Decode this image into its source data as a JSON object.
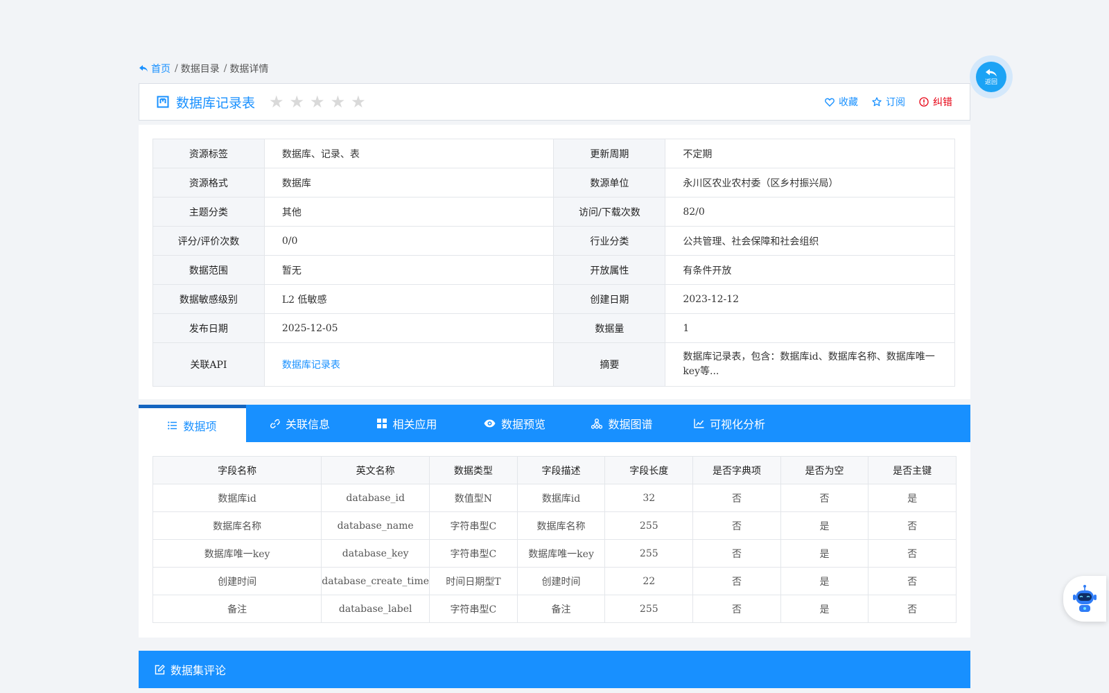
{
  "breadcrumb": {
    "home": "首页",
    "items": [
      "数据目录",
      "数据详情"
    ],
    "separator": "/"
  },
  "header": {
    "title": "数据库记录表",
    "rating_stars": 0,
    "rating_max": 5,
    "actions": {
      "favorite": "收藏",
      "subscribe": "订阅",
      "report": "纠错"
    }
  },
  "info": {
    "rows": [
      {
        "k1": "资源标签",
        "v1": "数据库、记录、表",
        "k2": "更新周期",
        "v2": "不定期"
      },
      {
        "k1": "资源格式",
        "v1": "数据库",
        "k2": "数源单位",
        "v2": "永川区农业农村委（区乡村振兴局）"
      },
      {
        "k1": "主题分类",
        "v1": "其他",
        "k2": "访问/下载次数",
        "v2": "82/0"
      },
      {
        "k1": "评分/评价次数",
        "v1": "0/0",
        "k2": "行业分类",
        "v2": "公共管理、社会保障和社会组织"
      },
      {
        "k1": "数据范围",
        "v1": "暂无",
        "k2": "开放属性",
        "v2": "有条件开放"
      },
      {
        "k1": "数据敏感级别",
        "v1": "L2 低敏感",
        "k2": "创建日期",
        "v2": "2023-12-12"
      },
      {
        "k1": "发布日期",
        "v1": "2025-12-05",
        "k2": "数据量",
        "v2": "1"
      },
      {
        "k1": "关联API",
        "v1": "数据库记录表",
        "k2": "摘要",
        "v2": "数据库记录表，包含：数据库id、数据库名称、数据库唯一key等..."
      }
    ]
  },
  "tabs": [
    {
      "label": "数据项",
      "icon": "list-icon",
      "active": true
    },
    {
      "label": "关联信息",
      "icon": "link-icon",
      "active": false
    },
    {
      "label": "相关应用",
      "icon": "grid-icon",
      "active": false
    },
    {
      "label": "数据预览",
      "icon": "eye-icon",
      "active": false
    },
    {
      "label": "数据图谱",
      "icon": "graph-icon",
      "active": false
    },
    {
      "label": "可视化分析",
      "icon": "chart-icon",
      "active": false
    }
  ],
  "fields_table": {
    "headers": [
      "字段名称",
      "英文名称",
      "数据类型",
      "字段描述",
      "字段长度",
      "是否字典项",
      "是否为空",
      "是否主键"
    ],
    "rows": [
      [
        "数据库id",
        "database_id",
        "数值型N",
        "数据库id",
        "32",
        "否",
        "否",
        "是"
      ],
      [
        "数据库名称",
        "database_name",
        "字符串型C",
        "数据库名称",
        "255",
        "否",
        "是",
        "否"
      ],
      [
        "数据库唯一key",
        "database_key",
        "字符串型C",
        "数据库唯一key",
        "255",
        "否",
        "是",
        "否"
      ],
      [
        "创建时间",
        "database_create_time",
        "时间日期型T",
        "创建时间",
        "22",
        "否",
        "是",
        "否"
      ],
      [
        "备注",
        "database_label",
        "字符串型C",
        "备注",
        "255",
        "否",
        "是",
        "否"
      ]
    ]
  },
  "comments": {
    "title": "数据集评论"
  },
  "floating": {
    "back_label": "返回"
  },
  "colors": {
    "primary": "#1890ff",
    "danger": "#e60012",
    "page_bg": "#f2f4f7",
    "star_inactive": "#d9d9d9"
  }
}
